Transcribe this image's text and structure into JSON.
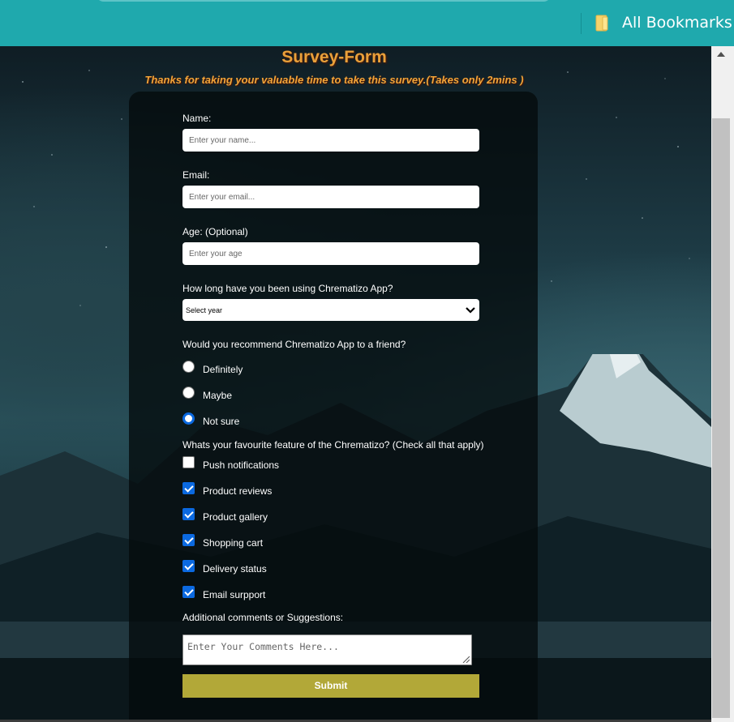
{
  "browser": {
    "bookmarks_label": "All Bookmarks",
    "bookmarks_icon": "bookmark-folder-icon"
  },
  "page": {
    "title": "Survey-Form",
    "subtitle": "Thanks for taking your valuable time to take this survey.(Takes only 2mins )"
  },
  "form": {
    "name": {
      "label": "Name:",
      "placeholder": "Enter your name..."
    },
    "email": {
      "label": "Email:",
      "placeholder": "Enter your email..."
    },
    "age": {
      "label": "Age: (Optional)",
      "placeholder": "Enter your age"
    },
    "usage": {
      "label": "How long have you been using Chrematizo App?",
      "selected": "Select year"
    },
    "recommend": {
      "label": "Would you recommend Chrematizo App to a friend?",
      "options": [
        {
          "label": "Definitely",
          "checked": false
        },
        {
          "label": "Maybe",
          "checked": false
        },
        {
          "label": "Not sure",
          "checked": true
        }
      ]
    },
    "features": {
      "label": "Whats your favourite feature of the Chrematizo? (Check all that apply)",
      "options": [
        {
          "label": "Push notifications",
          "checked": false
        },
        {
          "label": "Product reviews",
          "checked": true
        },
        {
          "label": "Product gallery",
          "checked": true
        },
        {
          "label": "Shopping cart",
          "checked": true
        },
        {
          "label": "Delivery status",
          "checked": true
        },
        {
          "label": "Email surpport",
          "checked": true
        }
      ]
    },
    "comments": {
      "label": "Additional comments or Suggestions:",
      "placeholder": "Enter Your Comments Here..."
    },
    "submit_label": "Submit"
  },
  "colors": {
    "browser_bar": "#1fa9ad",
    "title": "#e9a03a",
    "submit": "#b2a838",
    "accent": "#0b69e0"
  }
}
